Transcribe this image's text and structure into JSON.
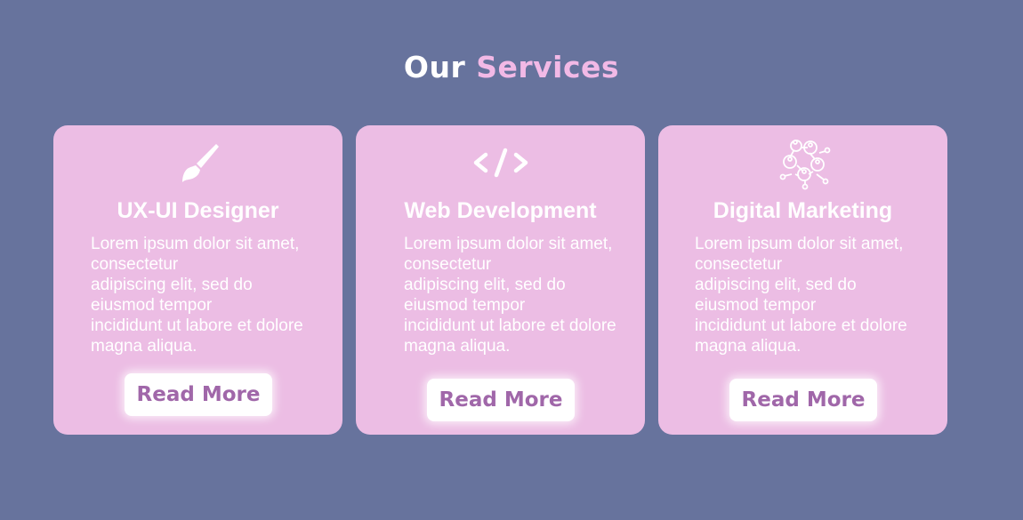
{
  "header": {
    "title_part1": "Our ",
    "title_part2": "Services"
  },
  "colors": {
    "background": "#67739d",
    "card": "#ecbde4",
    "accent": "#f2b9e6",
    "button_text": "#a067a9"
  },
  "cards": [
    {
      "icon": "paintbrush-icon",
      "title": "UX-UI Designer",
      "text": "Lorem ipsum dolor sit amet,\nconsectetur\nadipiscing elit, sed do\neiusmod tempor\nincididunt ut labore et dolore\nmagna aliqua.",
      "button_label": "Read More"
    },
    {
      "icon": "code-icon",
      "title": "Web Development",
      "text": "Lorem ipsum dolor sit amet,\nconsectetur\nadipiscing elit, sed do\neiusmod tempor\nincididunt ut labore et dolore\nmagna aliqua.",
      "button_label": "Read More"
    },
    {
      "icon": "network-people-icon",
      "title": "Digital Marketing",
      "text": "Lorem ipsum dolor sit amet,\nconsectetur\nadipiscing elit, sed do\neiusmod tempor\nincididunt ut labore et dolore\nmagna aliqua.",
      "button_label": "Read More"
    }
  ]
}
